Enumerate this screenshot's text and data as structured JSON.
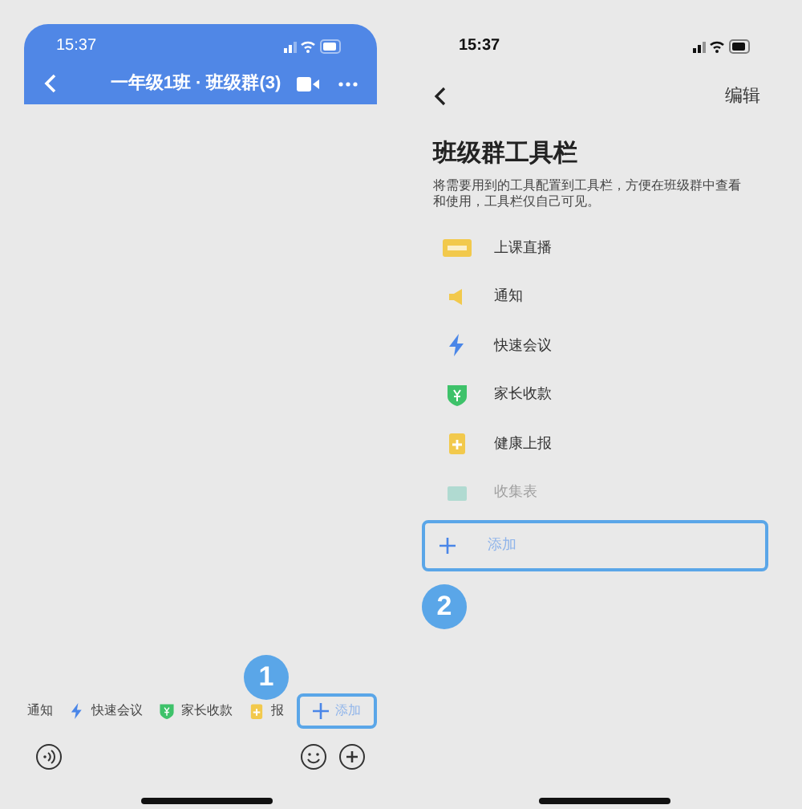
{
  "left": {
    "status_time": "15:37",
    "title": "一年级1班 · 班级群(3)",
    "toolbar": [
      {
        "label": "通知",
        "kind": "text"
      },
      {
        "label": "快速会议",
        "kind": "bolt"
      },
      {
        "label": "家长收款",
        "kind": "shield"
      },
      {
        "label": "报",
        "kind": "clip"
      },
      {
        "label": "添加",
        "kind": "add"
      }
    ],
    "badge": "1"
  },
  "right": {
    "status_time": "15:37",
    "edit": "编辑",
    "title": "班级群工具栏",
    "description": "将需要用到的工具配置到工具栏，方便在班级群中查看和使用，工具栏仅自己可见。",
    "tools": [
      {
        "label": "上课直播",
        "kind": "live",
        "faded": false
      },
      {
        "label": "通知",
        "kind": "speaker",
        "faded": false
      },
      {
        "label": "快速会议",
        "kind": "bolt",
        "faded": false
      },
      {
        "label": "家长收款",
        "kind": "shield",
        "faded": false
      },
      {
        "label": "健康上报",
        "kind": "clip",
        "faded": false
      },
      {
        "label": "收集表",
        "kind": "form",
        "faded": true
      }
    ],
    "add": "添加",
    "badge": "2"
  }
}
